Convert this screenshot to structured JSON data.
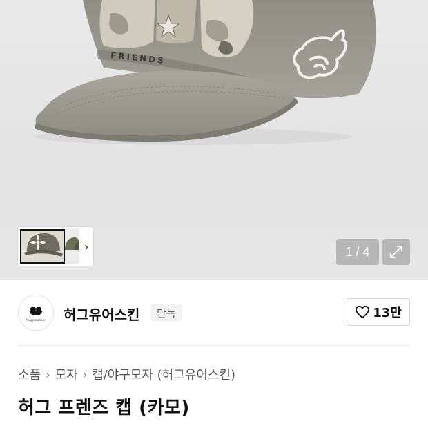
{
  "gallery": {
    "counter": "1 / 4",
    "next_thumbs_label": "›"
  },
  "brand": {
    "name": "허그유어스킨",
    "badge": "단독",
    "logo_text": "hugyourskin"
  },
  "like": {
    "count": "13만"
  },
  "breadcrumb": {
    "items": [
      "소품",
      "모자",
      "캡/야구모자 (허그유어스킨)"
    ],
    "separator": "›"
  },
  "product": {
    "title": "허그 프렌즈 캡 (카모)",
    "embroidery_text": "FRIENDS"
  },
  "colors": {
    "cap": "#9c9a90",
    "hero_bg": "#e6e6e6",
    "overlay": "#8a8a8a"
  }
}
